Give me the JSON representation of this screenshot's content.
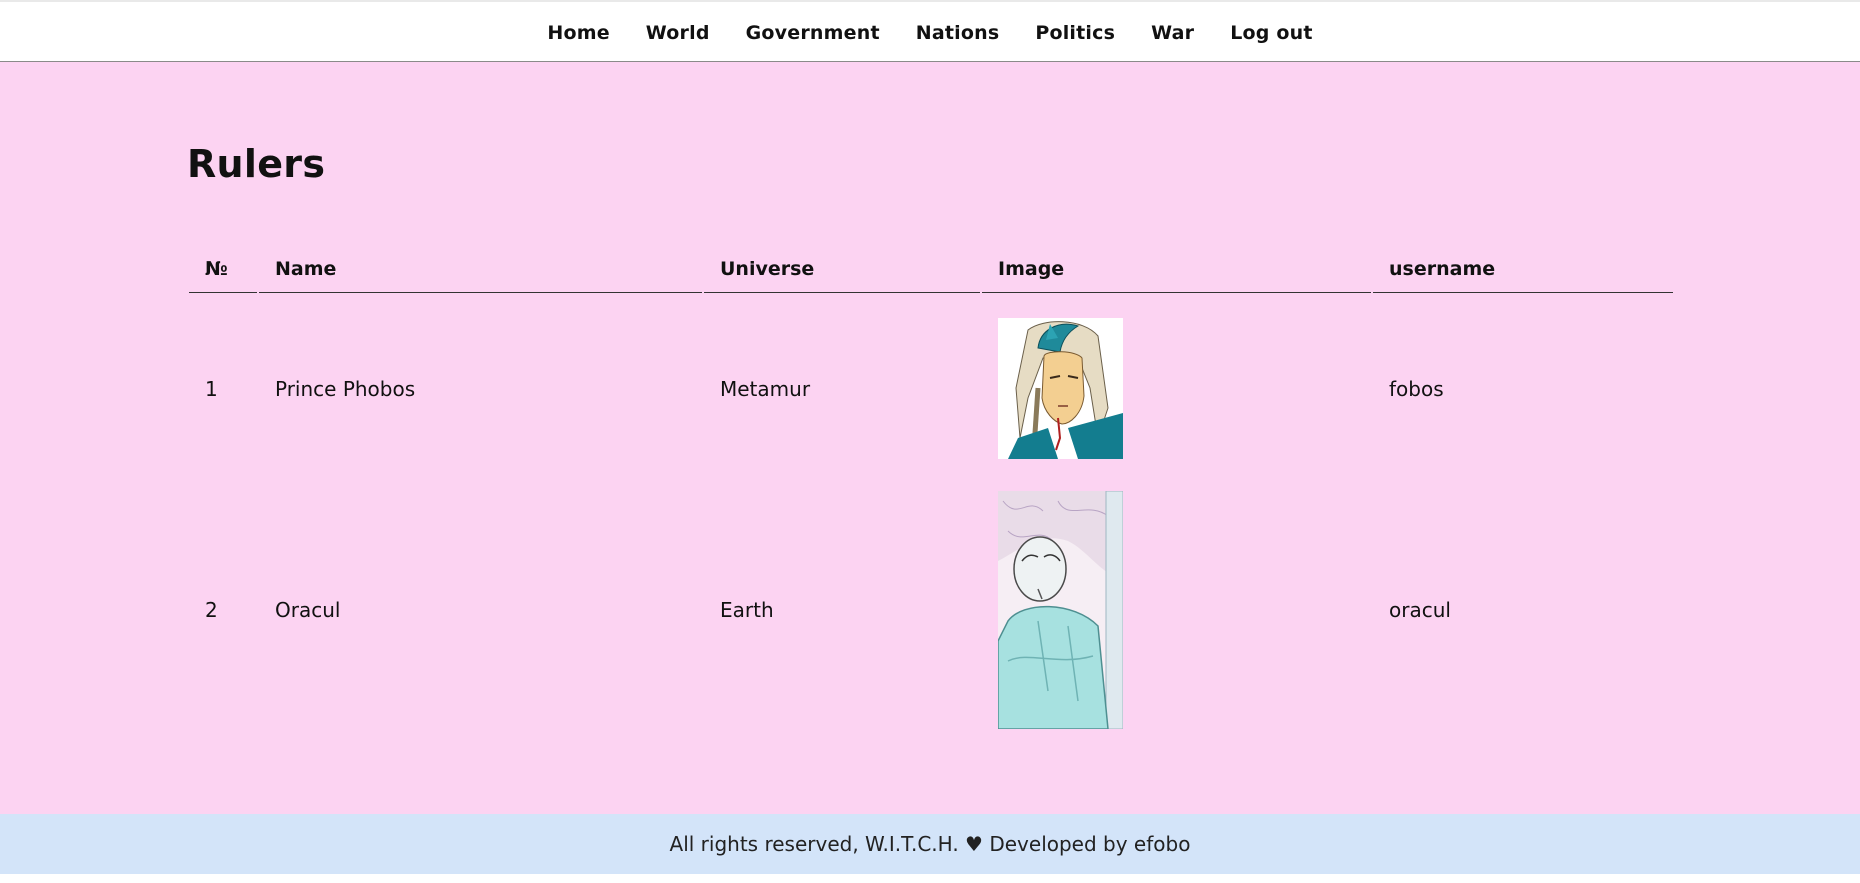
{
  "nav": {
    "items": [
      {
        "label": "Home"
      },
      {
        "label": "World"
      },
      {
        "label": "Government"
      },
      {
        "label": "Nations"
      },
      {
        "label": "Politics"
      },
      {
        "label": "War"
      },
      {
        "label": "Log out"
      }
    ]
  },
  "page": {
    "title": "Rulers"
  },
  "table": {
    "headers": [
      "№",
      "Name",
      "Universe",
      "Image",
      "username"
    ],
    "rows": [
      {
        "num": "1",
        "name": "Prince Phobos",
        "universe": "Metamur",
        "image_icon": "portrait-prince-phobos",
        "username": "fobos"
      },
      {
        "num": "2",
        "name": "Oracul",
        "universe": "Earth",
        "image_icon": "portrait-oracul",
        "username": "oracul"
      }
    ]
  },
  "footer": {
    "text": "All rights reserved, W.I.T.C.H. ♥ Developed by efobo"
  },
  "colors": {
    "main_bg": "#fcd3f2",
    "footer_bg": "#d3e4f9",
    "nav_bg": "#ffffff"
  }
}
